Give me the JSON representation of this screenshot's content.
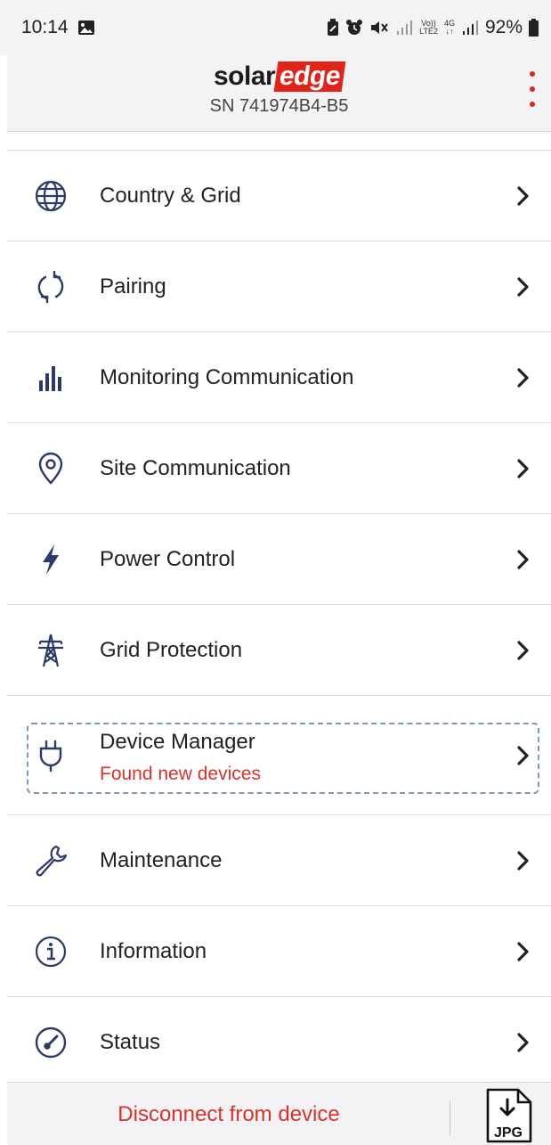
{
  "status_bar": {
    "time": "10:14",
    "network_top": "Vo))",
    "network_bottom": "LTE2",
    "network_type": "4G",
    "battery_percent": "92%"
  },
  "header": {
    "logo_part1": "solar",
    "logo_part2": "edge",
    "serial": "SN 741974B4-B5",
    "menu_icon": "kebab-menu-icon"
  },
  "menu": {
    "items": [
      {
        "label": "Country & Grid",
        "icon": "globe-icon"
      },
      {
        "label": "Pairing",
        "icon": "refresh-icon"
      },
      {
        "label": "Monitoring Communication",
        "icon": "bar-chart-icon"
      },
      {
        "label": "Site Communication",
        "icon": "location-pin-icon"
      },
      {
        "label": "Power Control",
        "icon": "lightning-icon"
      },
      {
        "label": "Grid Protection",
        "icon": "power-tower-icon"
      },
      {
        "label": "Device Manager",
        "sublabel": "Found new devices",
        "icon": "plug-icon"
      },
      {
        "label": "Maintenance",
        "icon": "wrench-icon"
      },
      {
        "label": "Information",
        "icon": "info-icon"
      },
      {
        "label": "Status",
        "icon": "gauge-icon"
      }
    ]
  },
  "bottom": {
    "disconnect_label": "Disconnect from device",
    "export_label": "JPG"
  },
  "colors": {
    "accent_red": "#e2231a",
    "alert_red": "#d8322a",
    "icon_navy": "#2b3a67",
    "background": "#f3f3f5"
  }
}
